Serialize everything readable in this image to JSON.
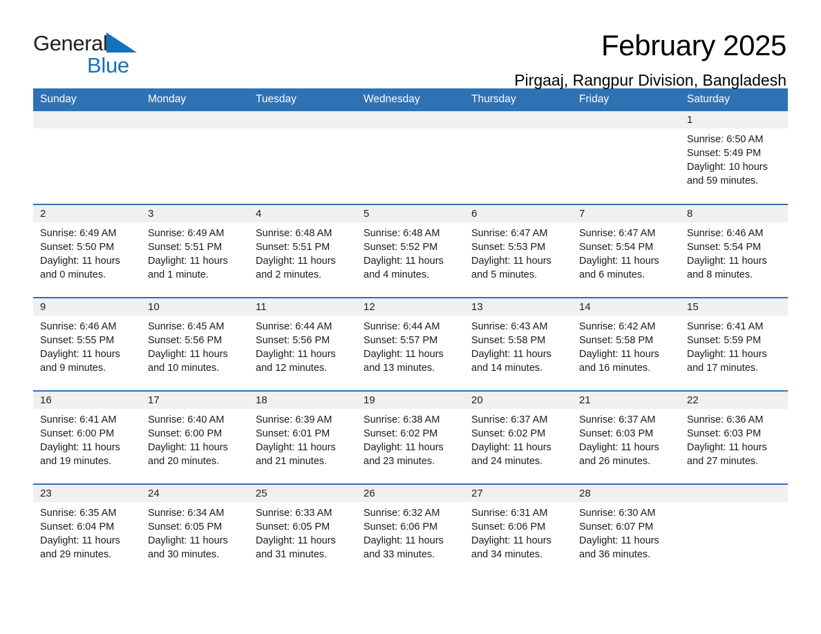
{
  "logo": {
    "text_primary": "General",
    "text_secondary": "Blue",
    "icon": "triangle-flag-icon",
    "primary_color": "#231f20",
    "secondary_color": "#1272bb"
  },
  "header": {
    "title": "February 2025",
    "location": "Pirgaaj, Rangpur Division, Bangladesh"
  },
  "theme": {
    "header_blue": "#2f72b4",
    "daynum_band": "#f0f0f0",
    "text": "#000000"
  },
  "calendar": {
    "weekday_headers": [
      "Sunday",
      "Monday",
      "Tuesday",
      "Wednesday",
      "Thursday",
      "Friday",
      "Saturday"
    ],
    "weeks": [
      [
        {
          "day": "",
          "empty": true
        },
        {
          "day": "",
          "empty": true
        },
        {
          "day": "",
          "empty": true
        },
        {
          "day": "",
          "empty": true
        },
        {
          "day": "",
          "empty": true
        },
        {
          "day": "",
          "empty": true
        },
        {
          "day": "1",
          "sunrise": "Sunrise: 6:50 AM",
          "sunset": "Sunset: 5:49 PM",
          "daylight": "Daylight: 10 hours and 59 minutes."
        }
      ],
      [
        {
          "day": "2",
          "sunrise": "Sunrise: 6:49 AM",
          "sunset": "Sunset: 5:50 PM",
          "daylight": "Daylight: 11 hours and 0 minutes."
        },
        {
          "day": "3",
          "sunrise": "Sunrise: 6:49 AM",
          "sunset": "Sunset: 5:51 PM",
          "daylight": "Daylight: 11 hours and 1 minute."
        },
        {
          "day": "4",
          "sunrise": "Sunrise: 6:48 AM",
          "sunset": "Sunset: 5:51 PM",
          "daylight": "Daylight: 11 hours and 2 minutes."
        },
        {
          "day": "5",
          "sunrise": "Sunrise: 6:48 AM",
          "sunset": "Sunset: 5:52 PM",
          "daylight": "Daylight: 11 hours and 4 minutes."
        },
        {
          "day": "6",
          "sunrise": "Sunrise: 6:47 AM",
          "sunset": "Sunset: 5:53 PM",
          "daylight": "Daylight: 11 hours and 5 minutes."
        },
        {
          "day": "7",
          "sunrise": "Sunrise: 6:47 AM",
          "sunset": "Sunset: 5:54 PM",
          "daylight": "Daylight: 11 hours and 6 minutes."
        },
        {
          "day": "8",
          "sunrise": "Sunrise: 6:46 AM",
          "sunset": "Sunset: 5:54 PM",
          "daylight": "Daylight: 11 hours and 8 minutes."
        }
      ],
      [
        {
          "day": "9",
          "sunrise": "Sunrise: 6:46 AM",
          "sunset": "Sunset: 5:55 PM",
          "daylight": "Daylight: 11 hours and 9 minutes."
        },
        {
          "day": "10",
          "sunrise": "Sunrise: 6:45 AM",
          "sunset": "Sunset: 5:56 PM",
          "daylight": "Daylight: 11 hours and 10 minutes."
        },
        {
          "day": "11",
          "sunrise": "Sunrise: 6:44 AM",
          "sunset": "Sunset: 5:56 PM",
          "daylight": "Daylight: 11 hours and 12 minutes."
        },
        {
          "day": "12",
          "sunrise": "Sunrise: 6:44 AM",
          "sunset": "Sunset: 5:57 PM",
          "daylight": "Daylight: 11 hours and 13 minutes."
        },
        {
          "day": "13",
          "sunrise": "Sunrise: 6:43 AM",
          "sunset": "Sunset: 5:58 PM",
          "daylight": "Daylight: 11 hours and 14 minutes."
        },
        {
          "day": "14",
          "sunrise": "Sunrise: 6:42 AM",
          "sunset": "Sunset: 5:58 PM",
          "daylight": "Daylight: 11 hours and 16 minutes."
        },
        {
          "day": "15",
          "sunrise": "Sunrise: 6:41 AM",
          "sunset": "Sunset: 5:59 PM",
          "daylight": "Daylight: 11 hours and 17 minutes."
        }
      ],
      [
        {
          "day": "16",
          "sunrise": "Sunrise: 6:41 AM",
          "sunset": "Sunset: 6:00 PM",
          "daylight": "Daylight: 11 hours and 19 minutes."
        },
        {
          "day": "17",
          "sunrise": "Sunrise: 6:40 AM",
          "sunset": "Sunset: 6:00 PM",
          "daylight": "Daylight: 11 hours and 20 minutes."
        },
        {
          "day": "18",
          "sunrise": "Sunrise: 6:39 AM",
          "sunset": "Sunset: 6:01 PM",
          "daylight": "Daylight: 11 hours and 21 minutes."
        },
        {
          "day": "19",
          "sunrise": "Sunrise: 6:38 AM",
          "sunset": "Sunset: 6:02 PM",
          "daylight": "Daylight: 11 hours and 23 minutes."
        },
        {
          "day": "20",
          "sunrise": "Sunrise: 6:37 AM",
          "sunset": "Sunset: 6:02 PM",
          "daylight": "Daylight: 11 hours and 24 minutes."
        },
        {
          "day": "21",
          "sunrise": "Sunrise: 6:37 AM",
          "sunset": "Sunset: 6:03 PM",
          "daylight": "Daylight: 11 hours and 26 minutes."
        },
        {
          "day": "22",
          "sunrise": "Sunrise: 6:36 AM",
          "sunset": "Sunset: 6:03 PM",
          "daylight": "Daylight: 11 hours and 27 minutes."
        }
      ],
      [
        {
          "day": "23",
          "sunrise": "Sunrise: 6:35 AM",
          "sunset": "Sunset: 6:04 PM",
          "daylight": "Daylight: 11 hours and 29 minutes."
        },
        {
          "day": "24",
          "sunrise": "Sunrise: 6:34 AM",
          "sunset": "Sunset: 6:05 PM",
          "daylight": "Daylight: 11 hours and 30 minutes."
        },
        {
          "day": "25",
          "sunrise": "Sunrise: 6:33 AM",
          "sunset": "Sunset: 6:05 PM",
          "daylight": "Daylight: 11 hours and 31 minutes."
        },
        {
          "day": "26",
          "sunrise": "Sunrise: 6:32 AM",
          "sunset": "Sunset: 6:06 PM",
          "daylight": "Daylight: 11 hours and 33 minutes."
        },
        {
          "day": "27",
          "sunrise": "Sunrise: 6:31 AM",
          "sunset": "Sunset: 6:06 PM",
          "daylight": "Daylight: 11 hours and 34 minutes."
        },
        {
          "day": "28",
          "sunrise": "Sunrise: 6:30 AM",
          "sunset": "Sunset: 6:07 PM",
          "daylight": "Daylight: 11 hours and 36 minutes."
        },
        {
          "day": "",
          "empty": true
        }
      ]
    ]
  }
}
